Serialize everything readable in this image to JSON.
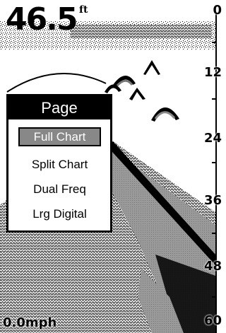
{
  "depth": {
    "value": "46.5",
    "unit": "ft"
  },
  "speed": {
    "value": "0.0mph"
  },
  "scale": {
    "labels": [
      "0",
      "12",
      "24",
      "36",
      "48",
      "60"
    ]
  },
  "menu": {
    "title": "Page",
    "items": [
      {
        "label": "Full Chart",
        "selected": true
      },
      {
        "label": "Split Chart",
        "selected": false
      },
      {
        "label": "Dual Freq",
        "selected": false
      },
      {
        "label": "Lrg Digital",
        "selected": false
      }
    ]
  },
  "icons": [
    "fish-arch-icon"
  ],
  "colors": {
    "background": "#ffffff",
    "foreground": "#000000",
    "highlight": "#888888"
  }
}
